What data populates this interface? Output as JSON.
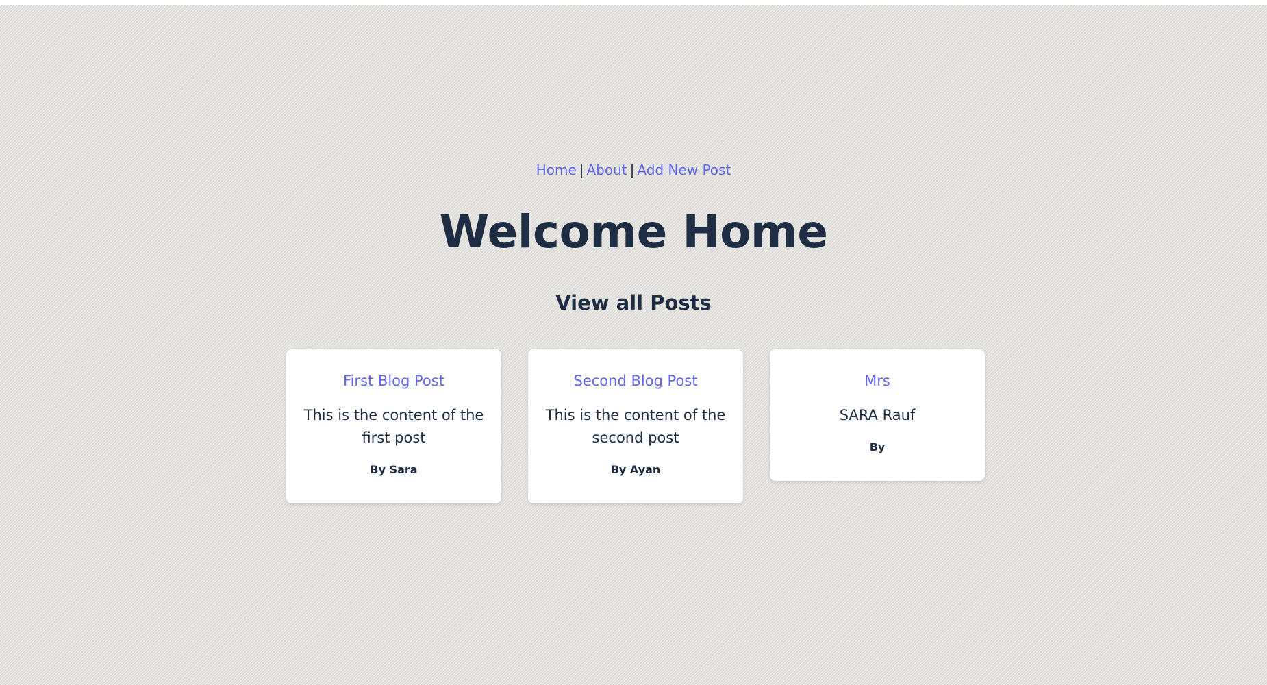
{
  "nav": {
    "links": [
      "Home",
      "About",
      "Add New Post"
    ],
    "separator": "|"
  },
  "page": {
    "title": "Welcome Home",
    "subtitle": "View all Posts"
  },
  "posts": [
    {
      "title": "First Blog Post",
      "body": "This is the content of the first post",
      "author": "By Sara"
    },
    {
      "title": "Second Blog Post",
      "body": "This is the content of the second post",
      "author": "By Ayan"
    },
    {
      "title": "Mrs",
      "body": "SARA Rauf",
      "author": "By"
    }
  ],
  "colors": {
    "link": "#6366f1",
    "text": "#1f2d44",
    "background": "#e3e2df",
    "card": "#ffffff"
  }
}
